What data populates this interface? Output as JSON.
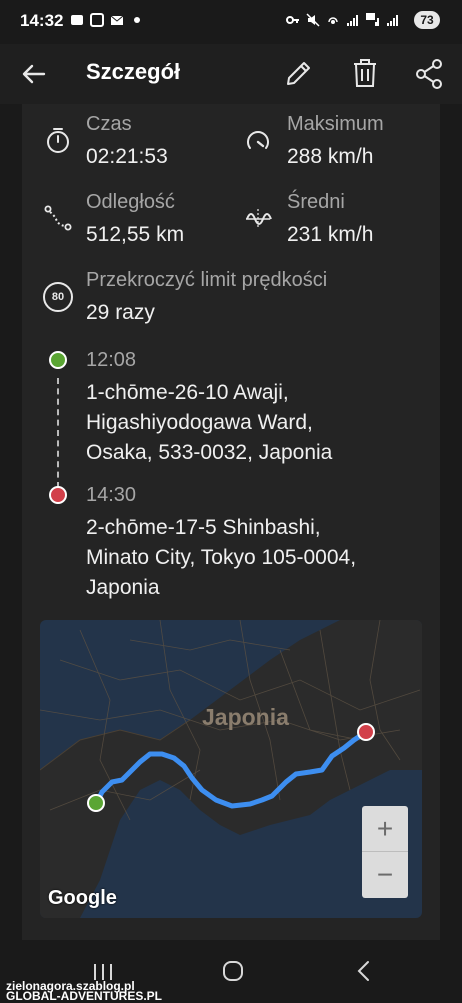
{
  "status_bar": {
    "time": "14:32",
    "battery": "73"
  },
  "app_bar": {
    "title": "Szczegół"
  },
  "stats": {
    "time_label": "Czas",
    "time_value": "02:21:53",
    "max_label": "Maksimum",
    "max_value": "288 km/h",
    "distance_label": "Odległość",
    "distance_value": "512,55 km",
    "avg_label": "Średni",
    "avg_value": "231 km/h",
    "limit_badge": "80",
    "limit_label": "Przekroczyć limit prędkości",
    "limit_value": "29 razy"
  },
  "route": {
    "start_time": "12:08",
    "start_address": "1-chōme-26-10 Awaji,\nHigashiyodogawa Ward,\nOsaka, 533-0032, Japonia",
    "end_time": "14:30",
    "end_address": "2-chōme-17-5 Shinbashi,\nMinato City, Tokyo 105-0004,\nJaponia"
  },
  "map": {
    "country_label": "Japonia",
    "provider": "Google",
    "zoom_in": "+",
    "zoom_out": "−",
    "route_color": "#3d8ef0",
    "start_color": "#5aa533",
    "end_color": "#d2404a"
  },
  "watermark": {
    "line1": "zielonagora.szablog.pl",
    "line2": "GLOBAL-ADVENTURES.PL"
  }
}
